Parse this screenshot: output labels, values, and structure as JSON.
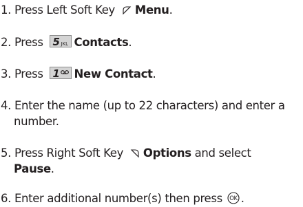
{
  "steps": [
    {
      "num": "1.",
      "text_before": " Press Left Soft Key ",
      "icon": "left-soft-key-icon",
      "bold": "Menu",
      "text_after": "."
    },
    {
      "num": "2.",
      "text_before": " Press ",
      "key_digit": "5",
      "key_letters": "JKL",
      "bold": "Contacts",
      "text_after": "."
    },
    {
      "num": "3.",
      "text_before": " Press ",
      "key_digit": "1",
      "key_letters": "voicemail",
      "bold": "New Contact",
      "text_after": "."
    },
    {
      "num": "4.",
      "line1": " Enter the name (up to 22 characters) and enter a",
      "line2": "number."
    },
    {
      "num": "5.",
      "text_before": " Press Right Soft Key ",
      "icon": "right-soft-key-icon",
      "bold": "Options",
      "text_mid": " and select",
      "bold2": "Pause",
      "text_after": "."
    },
    {
      "num": "6.",
      "text_before": " Enter additional number(s) then press ",
      "icon": "ok-key-icon",
      "text_after": "."
    }
  ]
}
